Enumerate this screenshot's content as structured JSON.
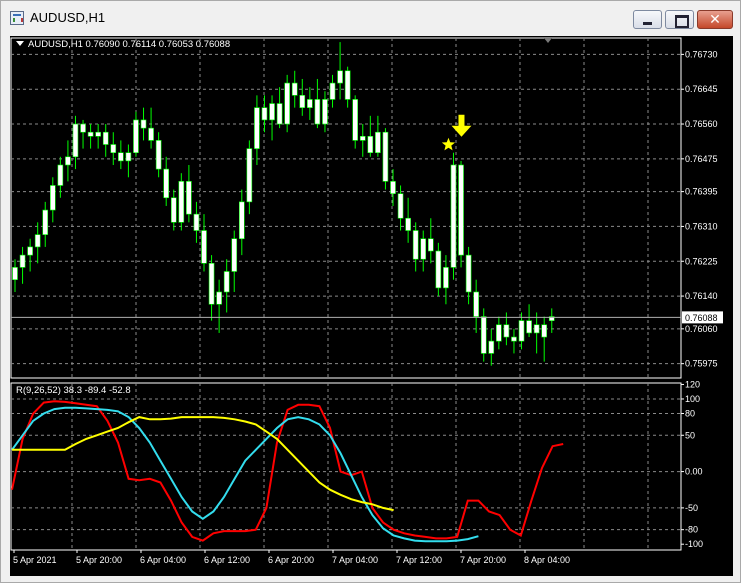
{
  "window": {
    "title": "AUDUSD,H1",
    "close_glyph": "✕"
  },
  "chart": {
    "symbol_legend": "AUDUSD,H1  0.76090 0.76114 0.76053 0.76088",
    "indicator_legend": "R(9,26,52) 38.3 -89.4 -52.8",
    "current_price_label": "0.76088",
    "price_axis_labels": [
      "0.76730",
      "0.76645",
      "0.76560",
      "0.76475",
      "0.76395",
      "0.76310",
      "0.76225",
      "0.76140",
      "0.76060",
      "0.75975"
    ],
    "indicator_axis_labels": [
      "120",
      "100",
      "80",
      "50",
      "0.00",
      "-50",
      "-80",
      "-100"
    ],
    "time_axis_labels": [
      "5 Apr 2021",
      "5 Apr 20:00",
      "6 Apr 04:00",
      "6 Apr 12:00",
      "6 Apr 20:00",
      "7 Apr 04:00",
      "7 Apr 12:00",
      "7 Apr 20:00",
      "8 Apr 04:00"
    ],
    "colors": {
      "background": "#000000",
      "grid": "#8a8a8a",
      "candle": "#ffffff",
      "wick": "#00ff00",
      "signal": "#ffff00",
      "line_fast": "#ff0000",
      "line_mid": "#33ddee",
      "line_slow": "#ffff00"
    },
    "signal_icons": [
      "star-icon",
      "down-arrow-icon"
    ]
  },
  "chart_data": {
    "type": "candlestick",
    "symbol": "AUDUSD",
    "timeframe": "H1",
    "ylim": [
      0.7594,
      0.7677
    ],
    "candles": [
      [
        0.7618,
        0.7623,
        0.7615,
        0.7621
      ],
      [
        0.7621,
        0.7626,
        0.7617,
        0.7624
      ],
      [
        0.7624,
        0.7628,
        0.762,
        0.7626
      ],
      [
        0.7626,
        0.7632,
        0.7622,
        0.7629
      ],
      [
        0.7629,
        0.7637,
        0.7626,
        0.7635
      ],
      [
        0.7635,
        0.7643,
        0.7632,
        0.7641
      ],
      [
        0.7641,
        0.7648,
        0.7638,
        0.7646
      ],
      [
        0.7646,
        0.7652,
        0.7642,
        0.7648
      ],
      [
        0.7648,
        0.7658,
        0.7645,
        0.7656
      ],
      [
        0.7656,
        0.7657,
        0.765,
        0.7654
      ],
      [
        0.7654,
        0.7656,
        0.765,
        0.7653
      ],
      [
        0.7653,
        0.7656,
        0.765,
        0.7654
      ],
      [
        0.7654,
        0.7656,
        0.7648,
        0.7651
      ],
      [
        0.7651,
        0.7654,
        0.7646,
        0.7649
      ],
      [
        0.7649,
        0.7652,
        0.7645,
        0.7647
      ],
      [
        0.7647,
        0.7651,
        0.7643,
        0.7649
      ],
      [
        0.7649,
        0.7659,
        0.7648,
        0.7657
      ],
      [
        0.7657,
        0.766,
        0.7652,
        0.7655
      ],
      [
        0.7655,
        0.766,
        0.765,
        0.7652
      ],
      [
        0.7652,
        0.7654,
        0.7643,
        0.7645
      ],
      [
        0.7645,
        0.7648,
        0.7636,
        0.7638
      ],
      [
        0.7638,
        0.764,
        0.763,
        0.7632
      ],
      [
        0.7632,
        0.7644,
        0.763,
        0.7642
      ],
      [
        0.7642,
        0.7646,
        0.7632,
        0.7634
      ],
      [
        0.7634,
        0.7637,
        0.7627,
        0.763
      ],
      [
        0.763,
        0.7634,
        0.762,
        0.7622
      ],
      [
        0.7622,
        0.7624,
        0.7608,
        0.7612
      ],
      [
        0.7612,
        0.7618,
        0.7605,
        0.7615
      ],
      [
        0.7615,
        0.7623,
        0.761,
        0.762
      ],
      [
        0.762,
        0.763,
        0.7615,
        0.7628
      ],
      [
        0.7628,
        0.764,
        0.7624,
        0.7637
      ],
      [
        0.7637,
        0.7652,
        0.7634,
        0.765
      ],
      [
        0.765,
        0.7663,
        0.7646,
        0.766
      ],
      [
        0.766,
        0.7663,
        0.7654,
        0.7657
      ],
      [
        0.7657,
        0.7663,
        0.7652,
        0.7661
      ],
      [
        0.7661,
        0.7665,
        0.7655,
        0.7656
      ],
      [
        0.7656,
        0.7668,
        0.7654,
        0.7666
      ],
      [
        0.7666,
        0.7669,
        0.766,
        0.7663
      ],
      [
        0.7663,
        0.7667,
        0.7658,
        0.766
      ],
      [
        0.766,
        0.7665,
        0.7657,
        0.7662
      ],
      [
        0.7662,
        0.7667,
        0.7655,
        0.7656
      ],
      [
        0.7656,
        0.7664,
        0.7654,
        0.7662
      ],
      [
        0.7662,
        0.7668,
        0.766,
        0.7666
      ],
      [
        0.7666,
        0.7676,
        0.7662,
        0.7669
      ],
      [
        0.7669,
        0.767,
        0.766,
        0.7662
      ],
      [
        0.7662,
        0.7663,
        0.765,
        0.7652
      ],
      [
        0.7652,
        0.7656,
        0.7648,
        0.7653
      ],
      [
        0.7653,
        0.7658,
        0.7648,
        0.7649
      ],
      [
        0.7649,
        0.7658,
        0.7648,
        0.7654
      ],
      [
        0.7654,
        0.7655,
        0.764,
        0.7642
      ],
      [
        0.7642,
        0.7645,
        0.7636,
        0.7639
      ],
      [
        0.7639,
        0.7641,
        0.763,
        0.7633
      ],
      [
        0.7633,
        0.7638,
        0.7627,
        0.763
      ],
      [
        0.763,
        0.7632,
        0.762,
        0.7623
      ],
      [
        0.7623,
        0.763,
        0.762,
        0.7628
      ],
      [
        0.7628,
        0.7633,
        0.7622,
        0.7625
      ],
      [
        0.7625,
        0.7627,
        0.7614,
        0.7616
      ],
      [
        0.7616,
        0.7624,
        0.7612,
        0.7621
      ],
      [
        0.7621,
        0.7649,
        0.7618,
        0.7646
      ],
      [
        0.7646,
        0.7647,
        0.7621,
        0.7624
      ],
      [
        0.7624,
        0.7626,
        0.7612,
        0.7615
      ],
      [
        0.7615,
        0.7618,
        0.7605,
        0.7609
      ],
      [
        0.7609,
        0.7611,
        0.7598,
        0.76
      ],
      [
        0.76,
        0.7606,
        0.7597,
        0.7603
      ],
      [
        0.7603,
        0.7609,
        0.7601,
        0.7607
      ],
      [
        0.7607,
        0.761,
        0.7602,
        0.7604
      ],
      [
        0.7604,
        0.7606,
        0.76,
        0.7603
      ],
      [
        0.7603,
        0.761,
        0.7601,
        0.7608
      ],
      [
        0.7608,
        0.7612,
        0.7604,
        0.7605
      ],
      [
        0.7605,
        0.761,
        0.76,
        0.7607
      ],
      [
        0.7607,
        0.7609,
        0.7598,
        0.7604
      ],
      [
        0.7609,
        0.7611,
        0.7605,
        0.7608
      ]
    ],
    "current_price": 0.76088,
    "signal_candle_index": 58,
    "indicator": {
      "name": "R(9,26,52)",
      "ylim": [
        -108,
        122
      ],
      "series": [
        {
          "name": "R9",
          "color": "#ff0000",
          "values": [
            -25,
            45,
            80,
            95,
            97,
            96,
            94,
            92,
            90,
            70,
            40,
            -10,
            -12,
            -10,
            -15,
            -40,
            -70,
            -90,
            -95,
            -85,
            -82,
            -82,
            -82,
            -80,
            -50,
            40,
            85,
            92,
            92,
            90,
            60,
            0,
            -5,
            0,
            -50,
            -70,
            -80,
            -85,
            -88,
            -90,
            -92,
            -92,
            -90,
            -40,
            -40,
            -55,
            -60,
            -80,
            -88,
            -40,
            5,
            35,
            38
          ]
        },
        {
          "name": "R26",
          "color": "#33ddee",
          "values": [
            30,
            50,
            70,
            80,
            86,
            88,
            88,
            87,
            86,
            85,
            83,
            75,
            60,
            40,
            15,
            -10,
            -35,
            -55,
            -65,
            -55,
            -35,
            -10,
            15,
            30,
            45,
            60,
            72,
            75,
            72,
            65,
            50,
            25,
            -5,
            -35,
            -60,
            -78,
            -88,
            -92,
            -95,
            -96,
            -96,
            -96,
            -95,
            -93,
            -89
          ]
        },
        {
          "name": "R52",
          "color": "#ffff00",
          "values": [
            30,
            30,
            30,
            30,
            30,
            30,
            38,
            45,
            50,
            55,
            60,
            68,
            75,
            72,
            72,
            73,
            75,
            75,
            75,
            75,
            74,
            72,
            69,
            65,
            55,
            45,
            30,
            15,
            0,
            -15,
            -25,
            -32,
            -38,
            -42,
            -45,
            -50,
            -53
          ]
        }
      ]
    }
  }
}
